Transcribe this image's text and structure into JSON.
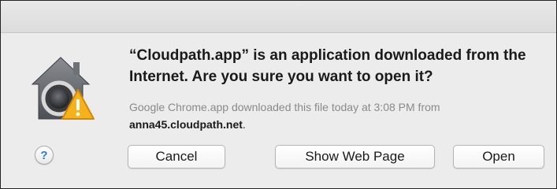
{
  "dialog": {
    "message": "“Cloudpath.app” is an application downloaded from the Internet. Are you sure you want to open it?",
    "info_prefix": "Google Chrome.app downloaded this file today at 3:08 PM from",
    "info_host": "anna45.cloudpath.net",
    "info_suffix": "."
  },
  "buttons": {
    "help_label": "?",
    "cancel_label": "Cancel",
    "show_web_page_label": "Show Web Page",
    "open_label": "Open"
  },
  "icons": {
    "app_icon": "gatekeeper-security-house-icon",
    "warning_icon": "warning-triangle-icon"
  },
  "colors": {
    "warning": "#f5b21b",
    "help_accent": "#2a7ae2"
  }
}
